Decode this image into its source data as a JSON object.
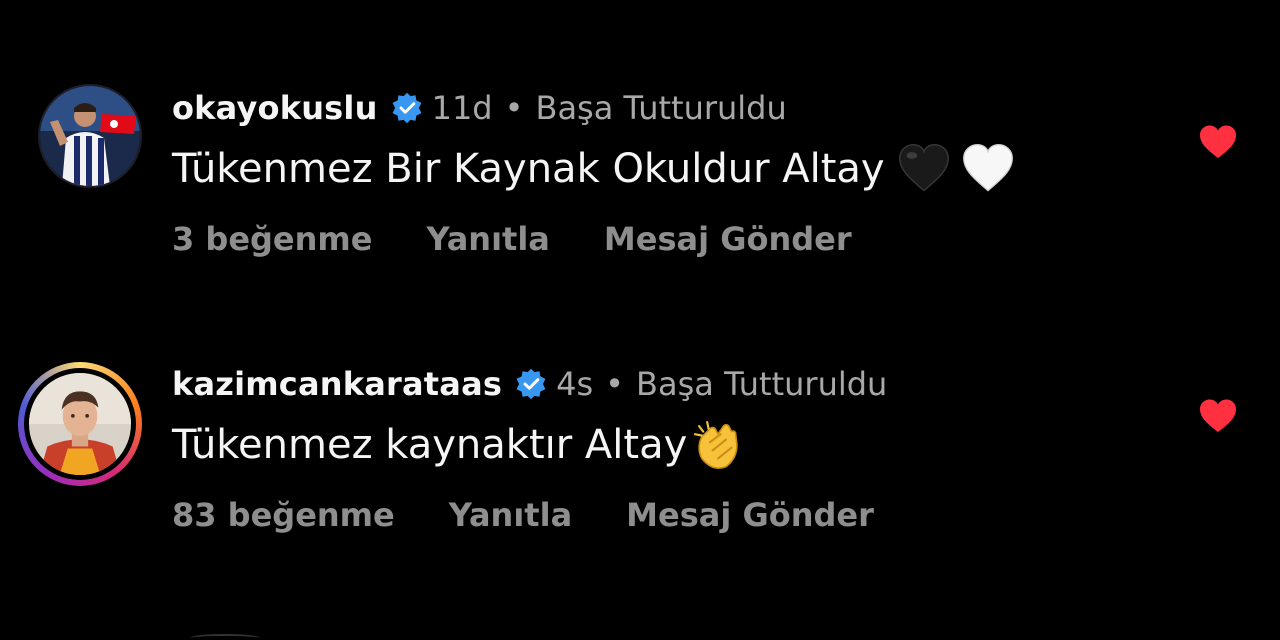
{
  "comments": [
    {
      "username": "okayokuslu",
      "time": "11d",
      "separator": "•",
      "pinned": "Başa Tutturuldu",
      "text": "Tükenmez Bir Kaynak Okuldur Altay",
      "emojis": [
        "black-heart",
        "white-heart"
      ],
      "likes": "3 beğenme",
      "reply": "Yanıtla",
      "send": "Mesaj Gönder",
      "liked": true
    },
    {
      "username": "kazimcankarataas",
      "time": "4s",
      "separator": "•",
      "pinned": "Başa Tutturuldu",
      "text": "Tükenmez kaynaktır Altay",
      "emojis": [
        "clapping-hands"
      ],
      "likes": "83 beğenme",
      "reply": "Yanıtla",
      "send": "Mesaj Gönder",
      "liked": true
    }
  ],
  "colors": {
    "background": "#000000",
    "primary_text": "#f5f5f5",
    "secondary_text": "#a8a8a8",
    "action_text": "#8e8e8e",
    "verified_blue": "#3897f0",
    "like_red": "#ff3040"
  }
}
